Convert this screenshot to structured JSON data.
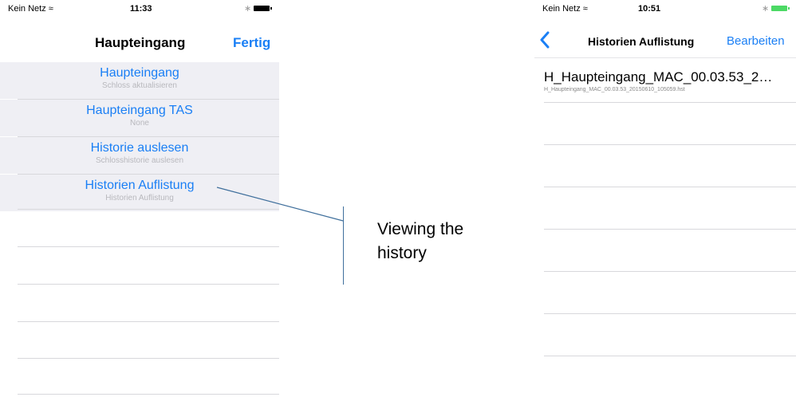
{
  "left_screen": {
    "status": {
      "carrier": "Kein Netz",
      "time": "11:33"
    },
    "nav": {
      "title": "Haupteingang",
      "done": "Fertig"
    },
    "menu": [
      {
        "title": "Haupteingang",
        "subtitle": "Schloss aktualisieren"
      },
      {
        "title": "Haupteingang TAS",
        "subtitle": "None"
      },
      {
        "title": "Historie auslesen",
        "subtitle": "Schlosshistorie auslesen"
      },
      {
        "title": "Historien Auflistung",
        "subtitle": "Historien Auflistung"
      }
    ]
  },
  "right_screen": {
    "status": {
      "carrier": "Kein Netz",
      "time": "10:51"
    },
    "nav": {
      "title": "Historien Auflistung",
      "edit": "Bearbeiten"
    },
    "items": [
      {
        "title": "H_Haupteingang_MAC_00.03.53_2…",
        "subtitle": "H_Haupteingang_MAC_00.03.53_20150610_105059.hst"
      }
    ]
  },
  "annotation": {
    "line1": "Viewing the",
    "line2": "history"
  },
  "colors": {
    "accent": "#1a7ff5",
    "row_bg": "#efeff4",
    "callout": "#3f6f9c",
    "battery_right": "#4cd964"
  },
  "icons": [
    "wifi-icon",
    "bluetooth-icon",
    "battery-icon",
    "back-chevron-icon"
  ]
}
